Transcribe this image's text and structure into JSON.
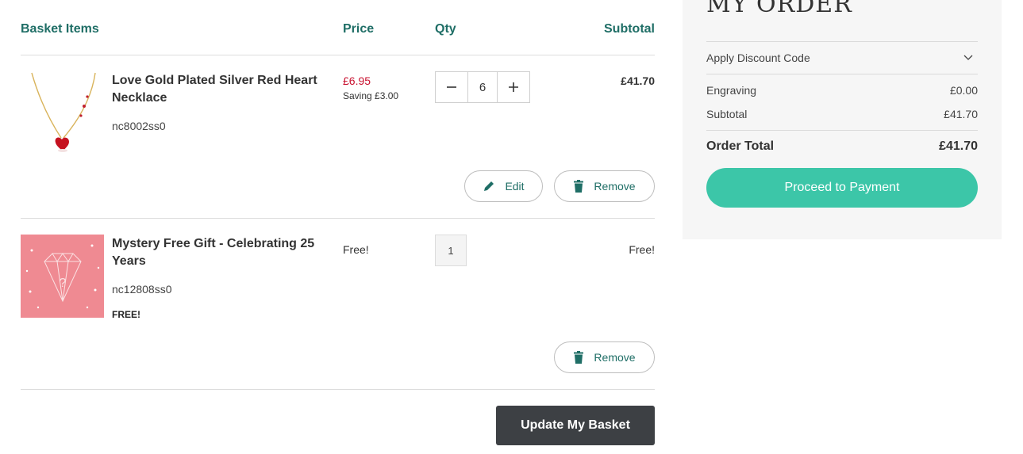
{
  "table": {
    "headers": {
      "items": "Basket Items",
      "price": "Price",
      "qty": "Qty",
      "subtotal": "Subtotal"
    }
  },
  "items": [
    {
      "title": "Love Gold Plated Silver Red Heart Necklace",
      "sku": "nc8002ss0",
      "price": "£6.95",
      "saving": "Saving £3.00",
      "qty": "6",
      "subtotal": "£41.70",
      "edit_label": "Edit",
      "remove_label": "Remove",
      "image": "heart-necklace-image"
    },
    {
      "title": "Mystery Free Gift - Celebrating 25 Years",
      "sku": "nc12808ss0",
      "tag": "FREE!",
      "price": "Free!",
      "qty": "1",
      "subtotal": "Free!",
      "remove_label": "Remove",
      "image": "mystery-diamond-image"
    }
  ],
  "update_label": "Update My Basket",
  "summary": {
    "title": "MY ORDER",
    "discount_label": "Apply Discount Code",
    "engraving_label": "Engraving",
    "engraving_value": "£0.00",
    "subtotal_label": "Subtotal",
    "subtotal_value": "£41.70",
    "total_label": "Order Total",
    "total_value": "£41.70",
    "proceed_label": "Proceed to Payment"
  },
  "colors": {
    "accent_teal": "#1f6e66",
    "price_red": "#c8102e",
    "proceed_green": "#3cc6a8",
    "update_dark": "#3d4044",
    "gift_pink": "#ef8a92"
  },
  "icons": [
    "minus-icon",
    "plus-icon",
    "pencil-icon",
    "trash-icon",
    "chevron-down-icon"
  ]
}
